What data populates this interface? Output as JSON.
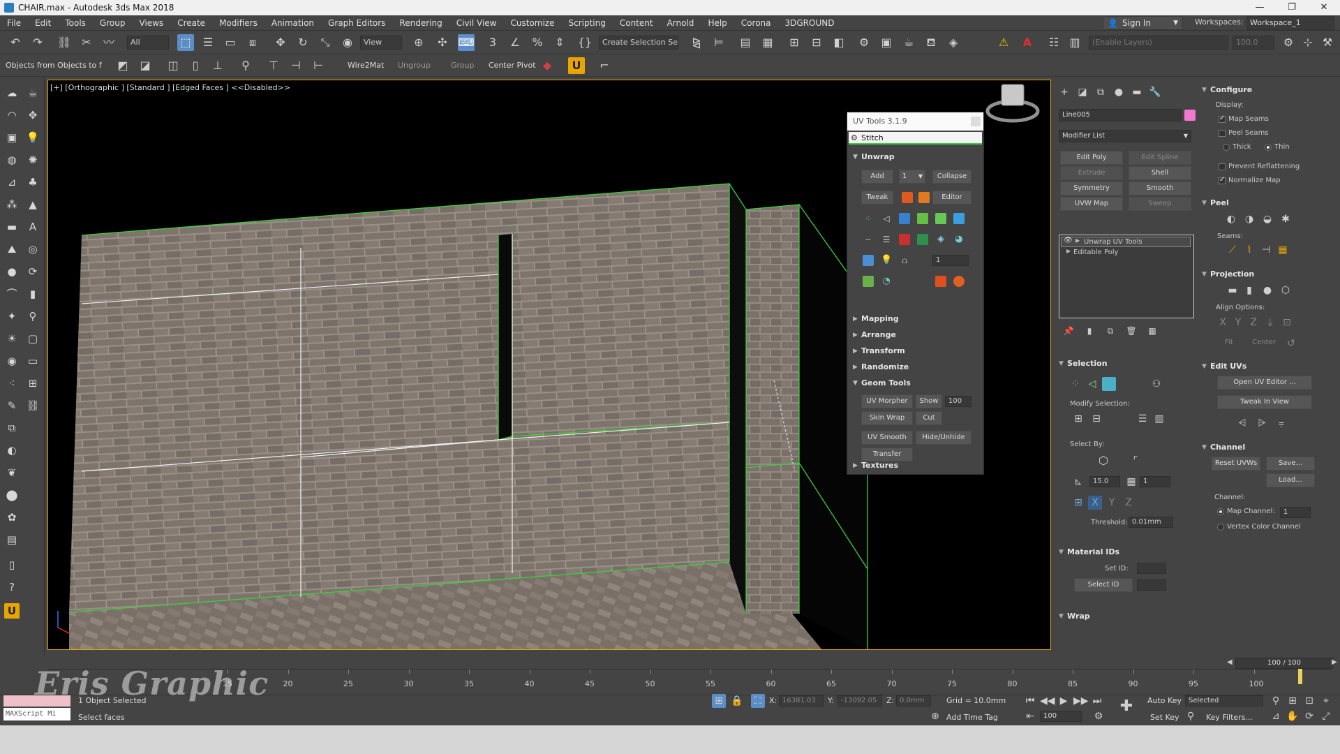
{
  "window": {
    "title": "CHAIR.max - Autodesk 3ds Max 2018",
    "minimize": "—",
    "maximize": "❐",
    "close": "✕"
  },
  "menu": {
    "items": [
      "File",
      "Edit",
      "Tools",
      "Group",
      "Views",
      "Create",
      "Modifiers",
      "Animation",
      "Graph Editors",
      "Rendering",
      "Civil View",
      "Customize",
      "Scripting",
      "Content",
      "Arnold",
      "Help",
      "Corona",
      "3DGROUND"
    ],
    "sign_in": "Sign In",
    "workspaces_label": "Workspaces:",
    "workspace_value": "Workspace_1"
  },
  "toolbar1": {
    "selection_filter": "All",
    "ref_coord": "View",
    "create_selection_set": "Create Selection Se",
    "enable_layers": "(Enable Layers)",
    "value_100": "100.0"
  },
  "toolbar2": {
    "objects_label": "Objects from Objects to f",
    "wire2mat": "Wire2Mat",
    "ungroup": "Ungroup",
    "group": "Group",
    "center_pivot": "Center Pivot"
  },
  "viewport": {
    "label": "[+] [Orthographic ] [Standard ] [Edged Faces ] <<Disabled>>"
  },
  "uvtools": {
    "title": "UV Tools 3.1.9",
    "stitch": "Stitch",
    "unwrap": "Unwrap",
    "add": "Add",
    "add_count": "1",
    "collapse": "Collapse",
    "tweak": "Tweak",
    "editor": "Editor",
    "spin_value": "1",
    "mapping": "Mapping",
    "arrange": "Arrange",
    "transform": "Transform",
    "randomize": "Randomize",
    "geom_tools": "Geom Tools",
    "uv_morpher": "UV Morpher",
    "show": "Show",
    "show_value": "100",
    "skin_wrap": "Skin Wrap",
    "cut": "Cut",
    "uv_smooth": "UV Smooth",
    "hide_unhide": "Hide/Unhide",
    "transfer": "Transfer",
    "textures": "Textures"
  },
  "cmd": {
    "object_name": "Line005",
    "modifier_list": "Modifier List",
    "btns": [
      [
        "Edit Poly",
        "Edit Spline"
      ],
      [
        "Extrude",
        "Shell"
      ],
      [
        "Symmetry",
        "Smooth"
      ],
      [
        "UVW Map",
        "Sweep"
      ]
    ],
    "stack": [
      "Unwrap UV Tools",
      "Editable Poly"
    ],
    "selection": "Selection",
    "modify_selection": "Modify Selection:",
    "select_by": "Select By:",
    "angle_value": "15.0",
    "ring_value": "1",
    "threshold_label": "Threshold:",
    "threshold_value": "0.01mm",
    "material_ids": "Material IDs",
    "set_id": "Set ID:",
    "select_id": "Select ID",
    "wrap": "Wrap"
  },
  "cmd2": {
    "configure": "Configure",
    "display": "Display:",
    "map_seams": "Map Seams",
    "peel_seams": "Peel Seams",
    "thick": "Thick",
    "thin": "Thin",
    "prevent_reflattening": "Prevent Reflattening",
    "normalize_map": "Normalize Map",
    "peel": "Peel",
    "seams": "Seams:",
    "projection": "Projection",
    "align_options": "Align Options:",
    "axis_x": "X",
    "axis_y": "Y",
    "axis_z": "Z",
    "fit": "Fit",
    "center": "Center",
    "edit_uvs": "Edit UVs",
    "open_uv_editor": "Open UV Editor ...",
    "tweak_in_view": "Tweak In View",
    "channel": "Channel",
    "reset_uvws": "Reset UVWs",
    "save": "Save...",
    "load": "Load...",
    "channel_label": "Channel:",
    "map_channel": "Map Channel:",
    "map_channel_value": "1",
    "vertex_color_channel": "Vertex Color Channel"
  },
  "timeline": {
    "slider": "100 / 100",
    "ticks": [
      "15",
      "20",
      "25",
      "30",
      "35",
      "40",
      "45",
      "50",
      "55",
      "60",
      "65",
      "70",
      "75",
      "80",
      "85",
      "90",
      "95",
      "100"
    ]
  },
  "status": {
    "maxscript": "MAXScript Mi",
    "objects_selected": "1 Object Selected",
    "prompt": "Select faces",
    "x_label": "X:",
    "x_value": "16381.03",
    "y_label": "Y:",
    "y_value": "-13092.05",
    "z_label": "Z:",
    "z_value": "0.0mm",
    "grid": "Grid = 10.0mm",
    "add_time_tag": "Add Time Tag",
    "auto_key": "Auto Key",
    "selected": "Selected",
    "set_key": "Set Key",
    "key_filters": "Key Filters...",
    "frame": "100"
  },
  "watermark": "Eris Graphic",
  "colors": {
    "accent_blue": "#5b8ec7",
    "viewport_border": "#e8a500",
    "seam_green": "#3ad13a",
    "brick": "#8a8178"
  }
}
